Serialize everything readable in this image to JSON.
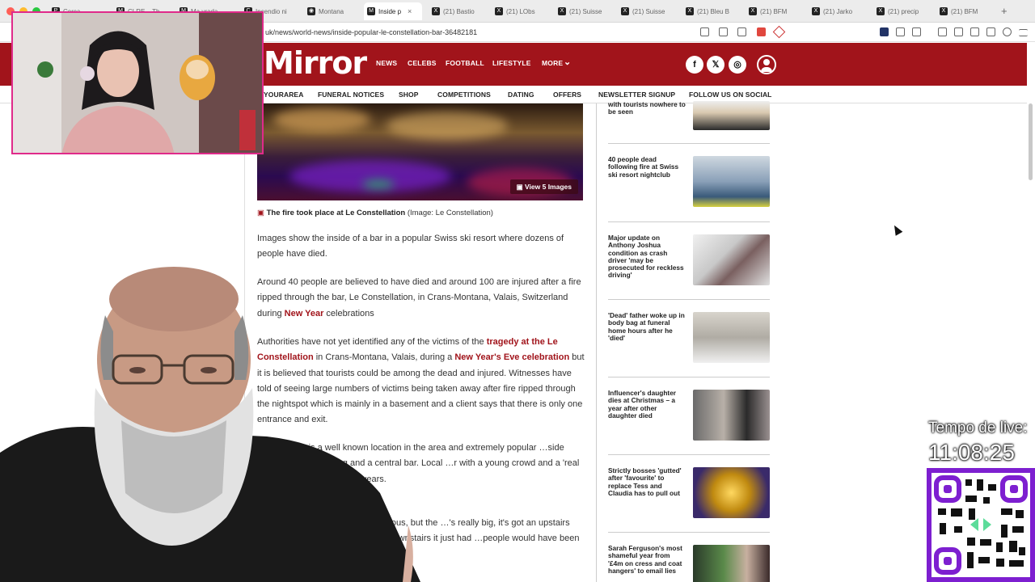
{
  "browser": {
    "tabs": [
      {
        "label": "Cerca",
        "icon": "P"
      },
      {
        "label": "CLRE – Th",
        "icon": "M"
      },
      {
        "label": "Ma vrada",
        "icon": "M"
      },
      {
        "label": "Incendio ni",
        "icon": "C"
      },
      {
        "label": "Montana",
        "icon": "◉"
      },
      {
        "label": "Inside p",
        "icon": "M"
      },
      {
        "label": "(21) Bastio",
        "icon": "X"
      },
      {
        "label": "(21) LObs",
        "icon": "X"
      },
      {
        "label": "(21) Suisse",
        "icon": "X"
      },
      {
        "label": "(21) Suisse",
        "icon": "X"
      },
      {
        "label": "(21) Bleu B",
        "icon": "X"
      },
      {
        "label": "(21) BFM",
        "icon": "X"
      },
      {
        "label": "(21) Jarko",
        "icon": "X"
      },
      {
        "label": "(21) precip",
        "icon": "X"
      },
      {
        "label": "(21) BFM",
        "icon": "X"
      }
    ],
    "new_tab": "+",
    "close_tab": "×",
    "url": "uk/news/world-news/inside-popular-le-constellation-bar-36482181"
  },
  "site": {
    "logo": "Mirror",
    "nav": [
      "NEWS",
      "CELEBS",
      "FOOTBALL",
      "LIFESTYLE",
      "MORE"
    ],
    "more_chevron": "⌄",
    "social": {
      "facebook": "f",
      "x": "𝕏",
      "instagram": "◎"
    },
    "subnav": [
      "YOURAREA",
      "FUNERAL NOTICES",
      "SHOP",
      "COMPETITIONS",
      "DATING",
      "OFFERS",
      "NEWSLETTER SIGNUP",
      "FOLLOW US ON SOCIAL"
    ]
  },
  "article": {
    "view_images": "View 5 Images",
    "caption_bold": "The fire took place at Le Constellation",
    "caption_credit": "(Image: Le Constellation)",
    "p1": "Images show the inside of a bar in a popular Swiss ski resort where dozens of people have died.",
    "p2_a": "Around 40 people are believed to have died and around 100 are injured after a fire ripped through the bar, Le Constellation, in Crans-Montana, Valais, Switzerland during ",
    "p2_link": "New Year",
    "p2_b": " celebrations",
    "p3_a": "Authorities have not yet identified any of the victims of the ",
    "p3_link1": "tragedy at the Le Constellation",
    "p3_b": " in Crans-Montana, Valais, during a ",
    "p3_link2": "New Year's Eve celebration",
    "p3_c": " but it is believed that tourists could be among the dead and injured. Witnesses have told of seeing large numbers of victims being taken away after fire ripped through the nightspot which is mainly in a basement and a client says that there is only one entrance and exit.",
    "p4": "…nstellation is a well known location in the area and extremely popular …side showing purple lighting and a central bar. Local …r with a young crowd and a 'real institution' which has …40 years.",
    "p5": "…said: \"A lot of the bars are luxurious, but the …'s really big, it's got an upstairs with TV …atch football matches. Downstairs it just had …people would have been dancing and"
  },
  "sidebar": [
    {
      "title": "with tourists nowhere to be seen"
    },
    {
      "title": "40 people dead following fire at Swiss ski resort nightclub"
    },
    {
      "title": "Major update on Anthony Joshua condition as crash driver 'may be prosecuted for reckless driving'"
    },
    {
      "title": "'Dead' father woke up in body bag at funeral home hours after he 'died'"
    },
    {
      "title": "Influencer's daughter dies at Christmas – a year after other daughter died"
    },
    {
      "title": "Strictly bosses 'gutted' after 'favourite' to replace Tess and Claudia has to pull out"
    },
    {
      "title": "Sarah Ferguson's most shameful year from '£4m on cress and coat hangers' to email lies"
    }
  ],
  "overlay": {
    "live_label": "Tempo de live:",
    "live_time": "11:08:25"
  }
}
